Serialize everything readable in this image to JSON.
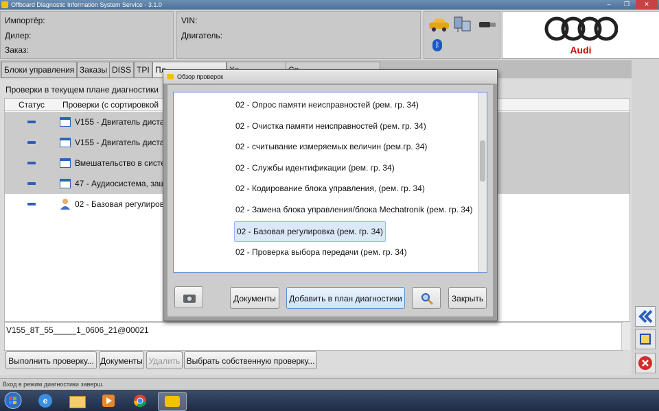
{
  "window": {
    "title": "Offboard Diagnostic Information System Service - 3.1.0",
    "controls": [
      "–",
      "❐",
      "✕"
    ]
  },
  "header": {
    "importer_label": "Импортёр:",
    "dealer_label": "Дилер:",
    "order_label": "Заказ:",
    "vin_label": "VIN:",
    "engine_label": "Двигатель:",
    "brand": "Audi",
    "bluetooth_glyph": "ᛒ"
  },
  "tabs": [
    "Блоки управления",
    "Заказы",
    "DISS",
    "TPI",
    "Пл",
    "Хо",
    "Сп"
  ],
  "main": {
    "plan_title": "Проверки в текущем плане диагностики",
    "col_status": "Статус",
    "col_checks": "Проверки (с сортировкой",
    "rows": [
      {
        "text": "V155 - Двигатель диста",
        "icon": "document-icon",
        "selected": true
      },
      {
        "text": "V155 - Двигатель диста",
        "icon": "document-icon",
        "selected": true
      },
      {
        "text": "Вмешательство в систе",
        "icon": "document-icon",
        "selected": true
      },
      {
        "text": "47 - Аудиосистема, защ",
        "icon": "document-icon",
        "selected": true
      },
      {
        "text": "02 - Базовая регулиров",
        "icon": "user-icon",
        "selected": false
      }
    ],
    "info_line": "V155_8T_55_____1_0606_21@00021"
  },
  "buttons": {
    "run_check": "Выполнить проверку...",
    "documents": "Документы",
    "delete": "Удалить",
    "choose_own": "Выбрать собственную проверку..."
  },
  "statusbar": "Вход в режим диагностики заверш.",
  "dialog": {
    "title": "Обзор проверок",
    "items": [
      "02 - Опрос памяти неисправностей (рем. гр. 34)",
      "02 - Очистка памяти неисправностей (рем. гр. 34)",
      "02 - считывание измеряемых величин (рем.гр. 34)",
      "02 - Службы идентификации (рем. гр. 34)",
      "02 - Кодирование блока управления, (рем. гр. 34)",
      "02 - Замена блока управления/блока Mechatronik (рем. гр. 34)",
      "02 - Базовая регулировка (рем. гр. 34)",
      "02 - Проверка выбора передачи (рем. гр. 34)"
    ],
    "selected_index": 6,
    "documents_label": "Документы",
    "add_label": "Добавить в план диагностики",
    "close_label": "Закрыть"
  },
  "colors": {
    "accent": "#2d5fb5",
    "audi_red": "#cc0000",
    "close_red": "#d42a2a"
  }
}
